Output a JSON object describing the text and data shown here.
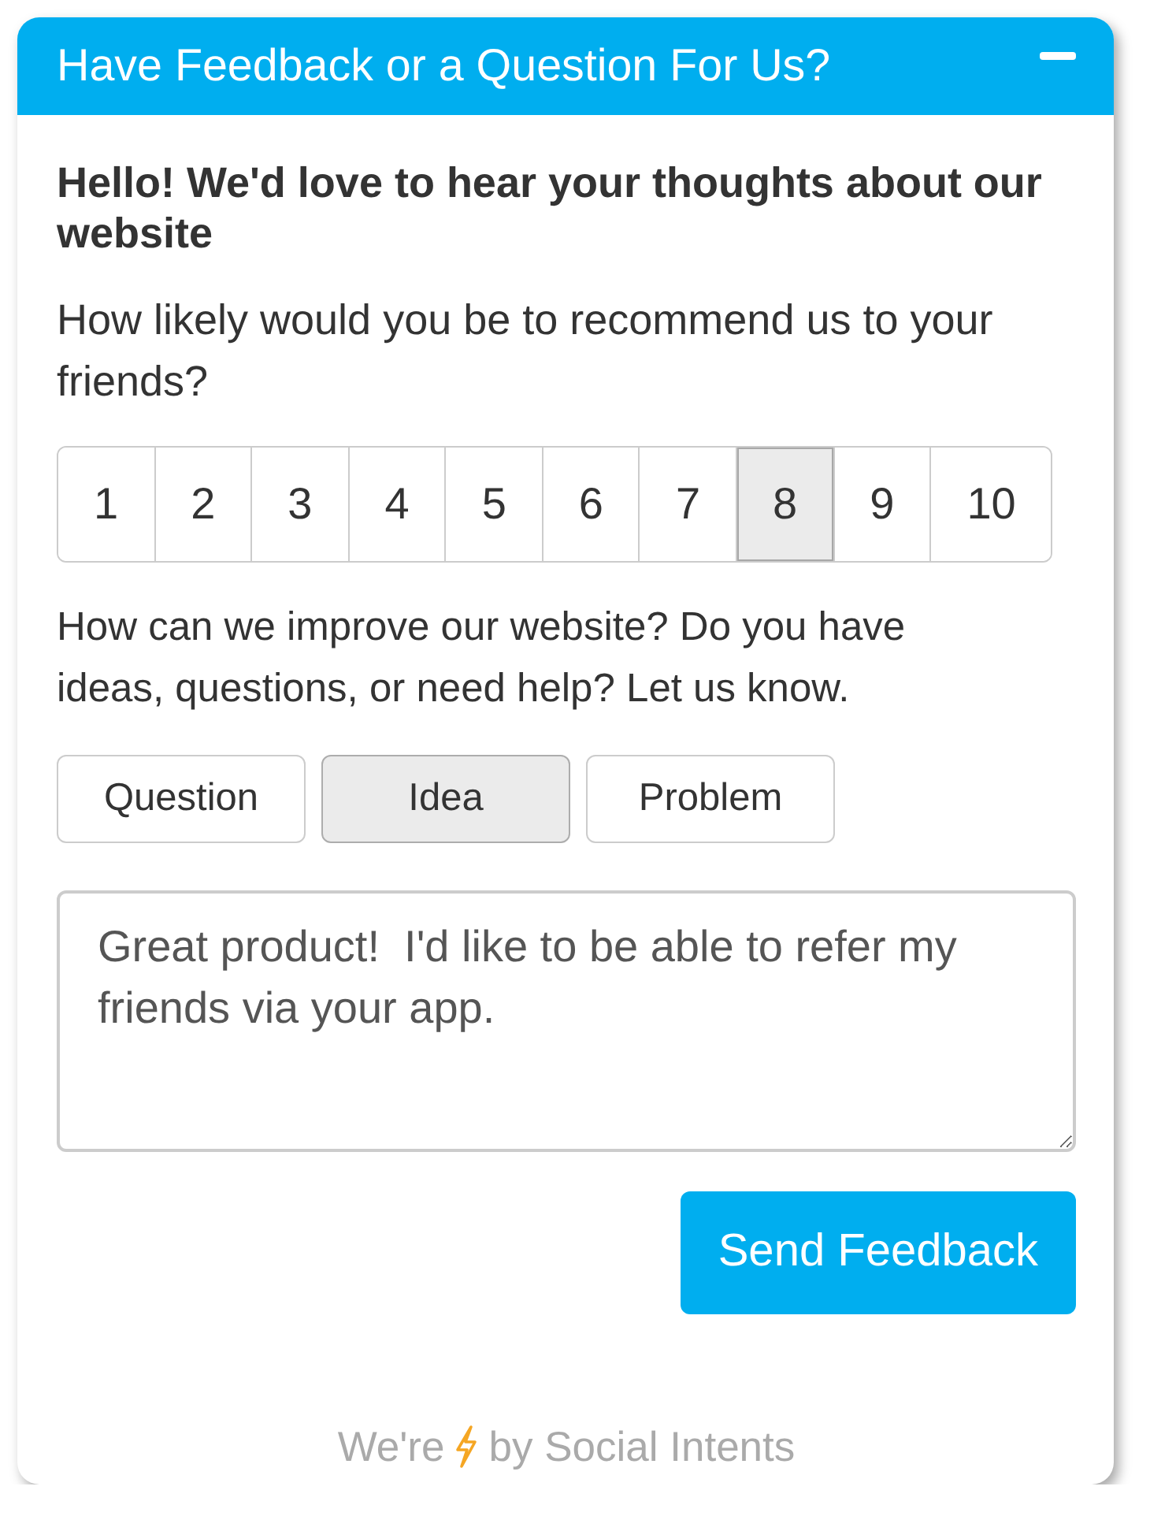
{
  "widget": {
    "title": "Have Feedback or a Question For Us?"
  },
  "intro": "Hello! We'd love to hear your thoughts about our website",
  "rating": {
    "question": "How likely would you be to recommend us to your friends?",
    "options": [
      {
        "label": "1",
        "selected": false
      },
      {
        "label": "2",
        "selected": false
      },
      {
        "label": "3",
        "selected": false
      },
      {
        "label": "4",
        "selected": false
      },
      {
        "label": "5",
        "selected": false
      },
      {
        "label": "6",
        "selected": false
      },
      {
        "label": "7",
        "selected": false
      },
      {
        "label": "8",
        "selected": true
      },
      {
        "label": "9",
        "selected": false
      },
      {
        "label": "10",
        "selected": false
      }
    ]
  },
  "feedback": {
    "prompt": "How can we improve our website? Do you have ideas, questions, or need help? Let us know.",
    "categories": [
      {
        "label": "Question",
        "selected": false
      },
      {
        "label": "Idea",
        "selected": true
      },
      {
        "label": "Problem",
        "selected": false
      }
    ],
    "message": "Great product!  I'd like to be able to refer my friends via your app."
  },
  "send_button": "Send Feedback",
  "footer": {
    "text_before_icon": "We're",
    "text_after_icon": "by Social Intents"
  }
}
